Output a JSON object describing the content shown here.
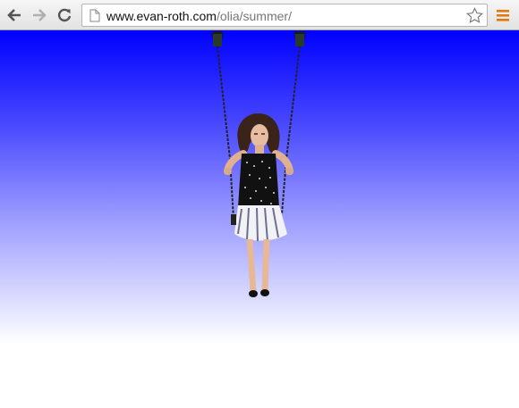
{
  "browser": {
    "url_host": "www.evan-roth.com",
    "url_path": "/olia/summer/",
    "icons": [
      "back-icon",
      "forward-icon",
      "reload-icon",
      "page-icon",
      "bookmark-star-icon",
      "menu-icon"
    ]
  },
  "page": {
    "sky_colors": [
      "#0000ff",
      "#ffffff"
    ]
  }
}
